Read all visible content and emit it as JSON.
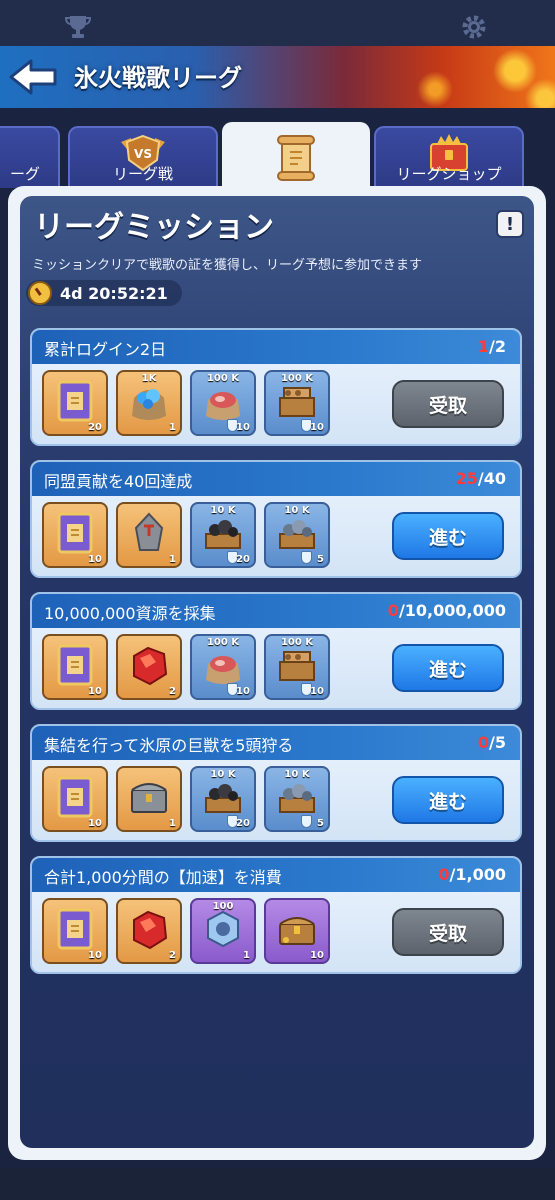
{
  "header": {
    "title": "氷火戦歌リーグ"
  },
  "tabs": [
    {
      "label": "ーグ"
    },
    {
      "label": "リーグ戦"
    },
    {
      "label": ""
    },
    {
      "label": "リーグショップ"
    }
  ],
  "panel": {
    "title": "リーグミッション",
    "info_label": "!",
    "subtitle": "ミッションクリアで戦歌の証を獲得し、リーグ予想に参加できます",
    "timer": "4d 20:52:21"
  },
  "missions": [
    {
      "title": "累計ログイン2日",
      "progress_current": "1",
      "progress_total": "/2",
      "button": "受取",
      "rewards": [
        {
          "icon": "league-token-icon",
          "top": "",
          "qty": "20"
        },
        {
          "icon": "gem-bag-icon",
          "top": "1K",
          "qty": "1"
        },
        {
          "icon": "meat-bag-icon",
          "top": "100 K",
          "qty": "10"
        },
        {
          "icon": "wood-crate-icon",
          "top": "100 K",
          "qty": "10"
        }
      ]
    },
    {
      "title": "同盟貢献を40回達成",
      "progress_current": "25",
      "progress_total": "/40",
      "button": "進む",
      "rewards": [
        {
          "icon": "league-token-icon",
          "top": "",
          "qty": "10"
        },
        {
          "icon": "whetstone-icon",
          "top": "",
          "qty": "1"
        },
        {
          "icon": "coal-crate-icon",
          "top": "10 K",
          "qty": "20"
        },
        {
          "icon": "iron-crate-icon",
          "top": "10 K",
          "qty": "5"
        }
      ]
    },
    {
      "title": "10,000,000資源を採集",
      "progress_current": "0",
      "progress_total": "/10,000,000",
      "button": "進む",
      "rewards": [
        {
          "icon": "league-token-icon",
          "top": "",
          "qty": "10"
        },
        {
          "icon": "red-crystal-icon",
          "top": "",
          "qty": "2"
        },
        {
          "icon": "meat-bag-icon",
          "top": "100 K",
          "qty": "10"
        },
        {
          "icon": "wood-crate-icon",
          "top": "100 K",
          "qty": "10"
        }
      ]
    },
    {
      "title": "集結を行って氷原の巨獣を5頭狩る",
      "progress_current": "0",
      "progress_total": "/5",
      "button": "進む",
      "rewards": [
        {
          "icon": "league-token-icon",
          "top": "",
          "qty": "10"
        },
        {
          "icon": "metal-chest-icon",
          "top": "",
          "qty": "1"
        },
        {
          "icon": "coal-crate-icon",
          "top": "10 K",
          "qty": "20"
        },
        {
          "icon": "iron-crate-icon",
          "top": "10 K",
          "qty": "5"
        }
      ]
    },
    {
      "title": "合計1,000分間の【加速】を消費",
      "progress_current": "0",
      "progress_total": "/1,000",
      "button": "受取",
      "rewards": [
        {
          "icon": "league-token-icon",
          "top": "",
          "qty": "10"
        },
        {
          "icon": "red-crystal-icon",
          "top": "",
          "qty": "2"
        },
        {
          "icon": "hex-nut-icon",
          "top": "100",
          "qty": "1"
        },
        {
          "icon": "treasure-chest-icon",
          "top": "",
          "qty": "10"
        }
      ]
    }
  ],
  "colors": {
    "progress_current": "#ff3b3b",
    "button_blue": "#1f78e6",
    "button_gray": "#5c636c",
    "header_blue": "#1f6fc0",
    "header_fire": "#f0761a"
  }
}
